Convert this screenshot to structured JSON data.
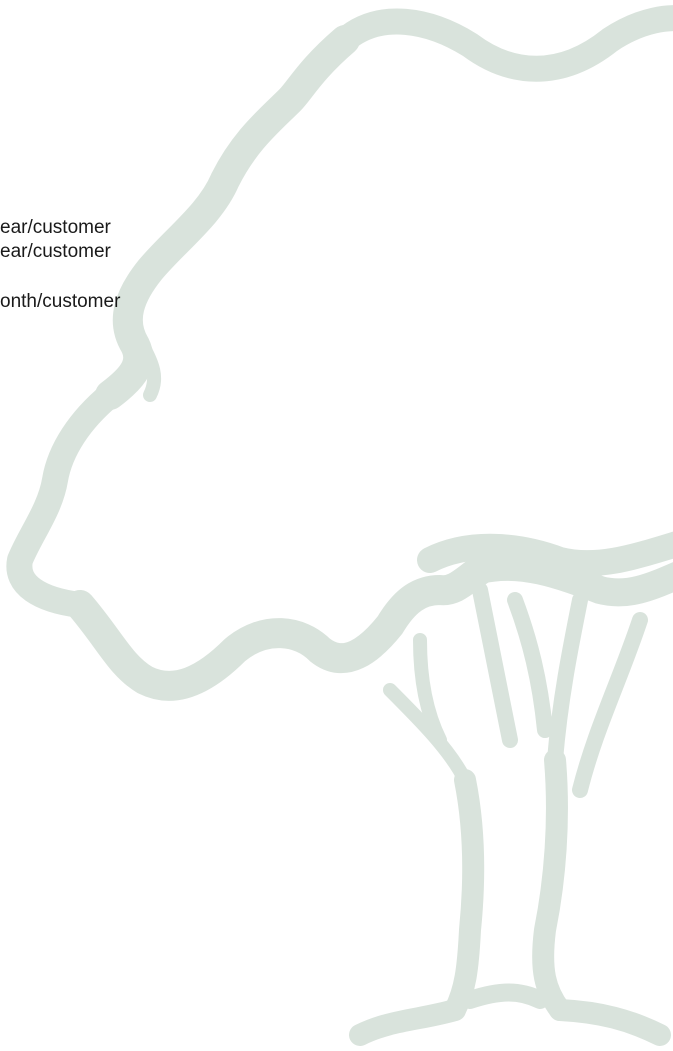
{
  "lines": [
    "ear/customer",
    "ear/customer",
    "onth/customer"
  ],
  "watermark": {
    "icon": "tree-icon",
    "color": "#d9e3dc"
  }
}
